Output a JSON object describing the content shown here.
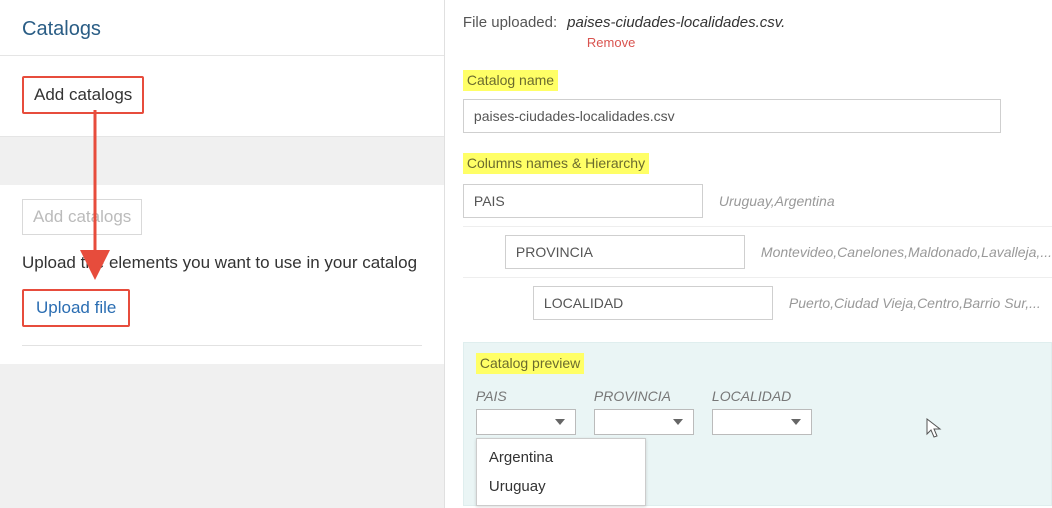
{
  "left": {
    "title": "Catalogs",
    "add_catalogs_label": "Add catalogs",
    "add_catalogs_ghost_label": "Add catalogs",
    "upload_instruction": "Upload the elements you want to use in your catalog",
    "upload_file_label": "Upload file"
  },
  "upload": {
    "label": "File uploaded:",
    "file_name": "paises-ciudades-localidades.csv.",
    "remove_label": "Remove"
  },
  "catalog_name": {
    "label": "Catalog name",
    "value": "paises-ciudades-localidades.csv"
  },
  "hierarchy": {
    "label": "Columns names & Hierarchy",
    "levels": [
      {
        "name": "PAIS",
        "hint": "Uruguay,Argentina"
      },
      {
        "name": "PROVINCIA",
        "hint": "Montevideo,Canelones,Maldonado,Lavalleja,..."
      },
      {
        "name": "LOCALIDAD",
        "hint": "Puerto,Ciudad Vieja,Centro,Barrio Sur,..."
      }
    ]
  },
  "preview": {
    "label": "Catalog preview",
    "columns": [
      "PAIS",
      "PROVINCIA",
      "LOCALIDAD"
    ],
    "open_dropdown_options": [
      "Argentina",
      "Uruguay"
    ]
  }
}
